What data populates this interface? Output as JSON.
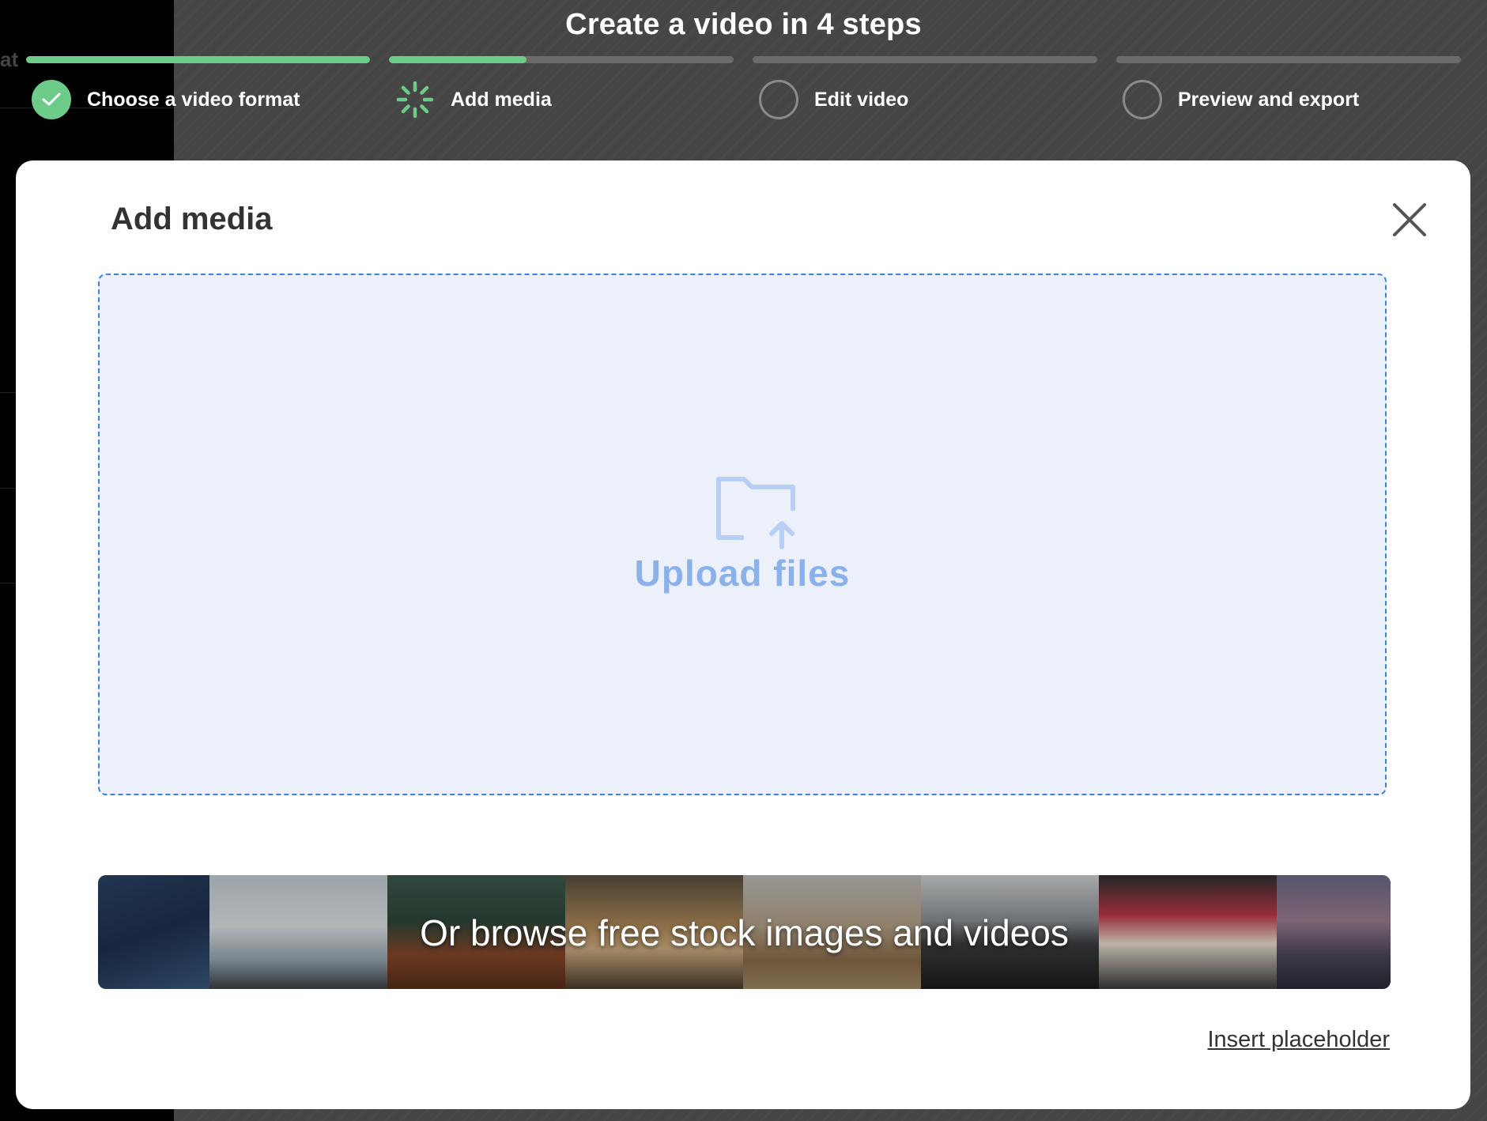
{
  "header": {
    "title": "Create a video in 4 steps",
    "steps": [
      {
        "label": "Choose a video format",
        "status": "done",
        "progress": 1.0
      },
      {
        "label": "Add media",
        "status": "in-progress",
        "progress": 0.4
      },
      {
        "label": "Edit video",
        "status": "todo",
        "progress": 0.0
      },
      {
        "label": "Preview and export",
        "status": "todo",
        "progress": 0.0
      }
    ]
  },
  "background": {
    "left_text": "at"
  },
  "modal": {
    "title": "Add media",
    "upload_label": "Upload files",
    "stock_label": "Or browse free stock images and videos",
    "placeholder_link": "Insert placeholder"
  },
  "icons": {
    "done_step": "check-icon",
    "active_step": "spinner-icon",
    "close": "close-icon",
    "upload": "folder-upload-icon"
  },
  "colors": {
    "accent_green": "#6dcc8a",
    "dropzone_bg": "#ebf0fb",
    "dropzone_border": "#3f7fe0",
    "upload_text": "#8ab1ea",
    "overlay_bg": "#454545"
  }
}
